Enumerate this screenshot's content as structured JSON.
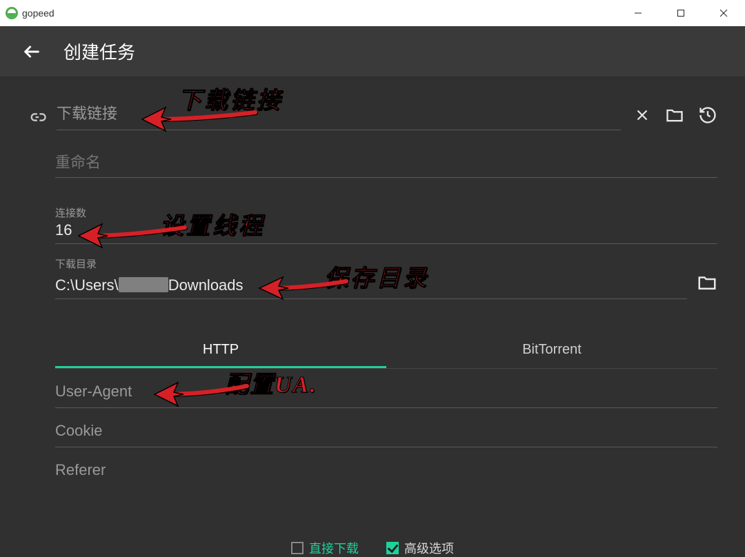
{
  "window": {
    "title": "gopeed"
  },
  "appbar": {
    "title": "创建任务"
  },
  "fields": {
    "url_placeholder": "下载链接",
    "rename_placeholder": "重命名",
    "connections_label": "连接数",
    "connections_value": "16",
    "dir_label": "下载目录",
    "dir_prefix": "C:\\Users\\",
    "dir_suffix": "Downloads"
  },
  "tabs": {
    "http": "HTTP",
    "bt": "BitTorrent"
  },
  "http_fields": {
    "ua": "User-Agent",
    "cookie": "Cookie",
    "referer": "Referer"
  },
  "bottom": {
    "direct": "直接下载",
    "advanced": "高级选项"
  },
  "annotations": {
    "download_link": "下载链接",
    "set_threads": "设置线程",
    "save_dir": "保存目录",
    "config_ua": "配置UA."
  }
}
